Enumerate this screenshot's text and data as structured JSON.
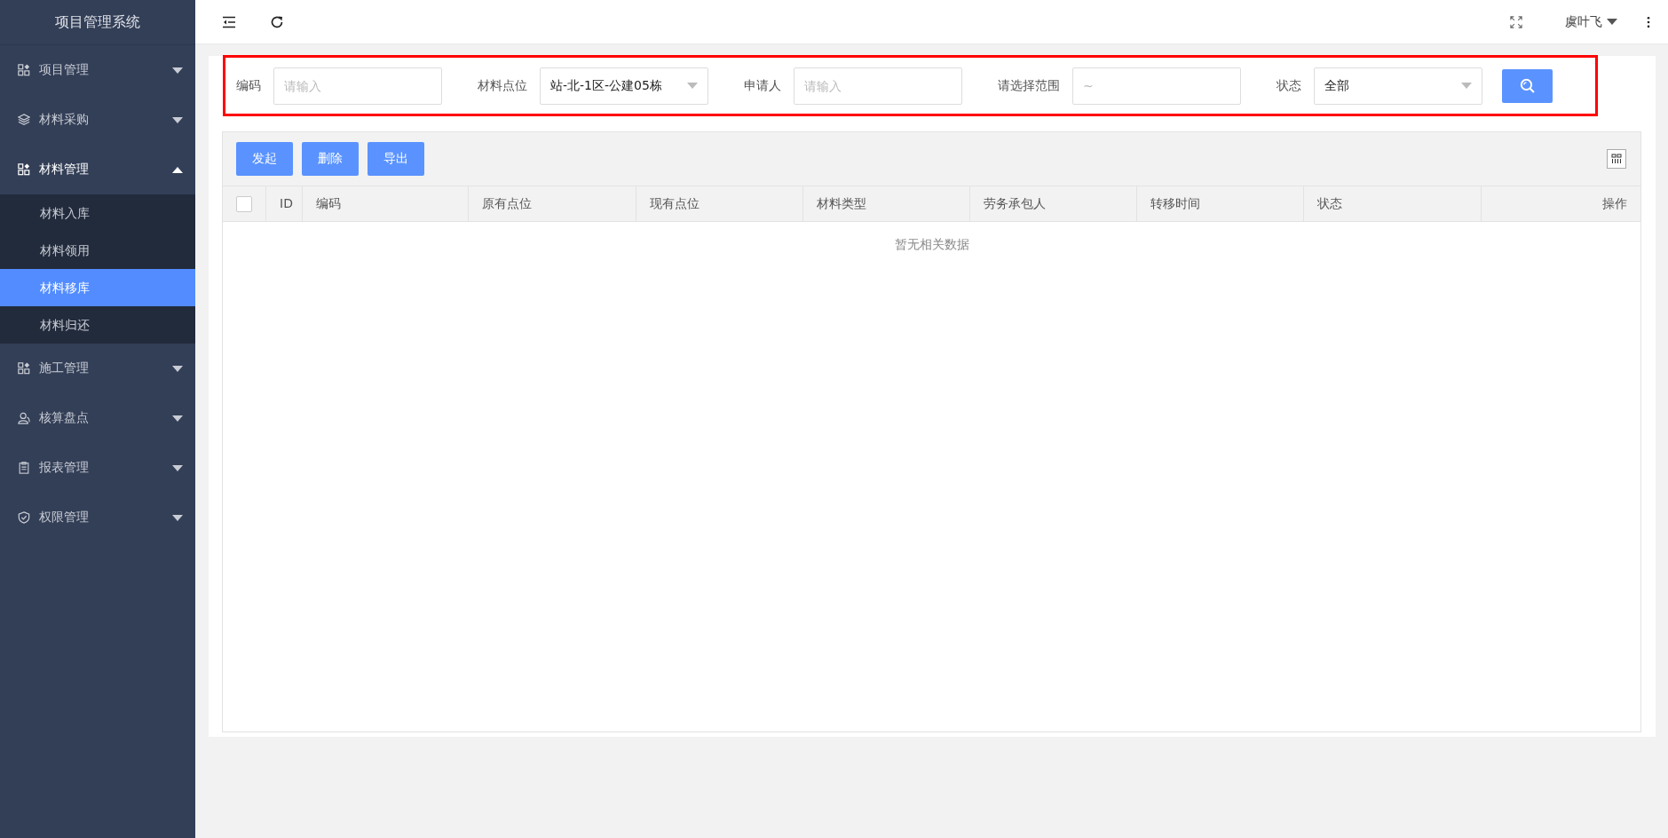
{
  "sidebar": {
    "title": "项目管理系统",
    "items": [
      {
        "label": "项目管理",
        "expanded": false
      },
      {
        "label": "材料采购",
        "expanded": false
      },
      {
        "label": "材料管理",
        "expanded": true,
        "children": [
          {
            "label": "材料入库",
            "selected": false
          },
          {
            "label": "材料领用",
            "selected": false
          },
          {
            "label": "材料移库",
            "selected": true
          },
          {
            "label": "材料归还",
            "selected": false
          }
        ]
      },
      {
        "label": "施工管理",
        "expanded": false
      },
      {
        "label": "核算盘点",
        "expanded": false
      },
      {
        "label": "报表管理",
        "expanded": false
      },
      {
        "label": "权限管理",
        "expanded": false
      }
    ]
  },
  "header": {
    "user": "虞叶飞"
  },
  "filters": [
    {
      "kind": "input",
      "label": "编码",
      "placeholder": "请输入"
    },
    {
      "kind": "select",
      "label": "材料点位",
      "value": "站-北-1区-公建05栋"
    },
    {
      "kind": "input",
      "label": "申请人",
      "placeholder": "请输入"
    },
    {
      "kind": "input",
      "label": "请选择范围",
      "placeholder": "~"
    },
    {
      "kind": "select",
      "label": "状态",
      "value": "全部"
    }
  ],
  "toolbar": {
    "buttons": [
      "发起",
      "删除",
      "导出"
    ]
  },
  "table": {
    "select_all_checked": false,
    "columns": [
      "ID",
      "编码",
      "原有点位",
      "现有点位",
      "材料类型",
      "劳务承包人",
      "转移时间",
      "状态",
      "操作"
    ],
    "empty_text": "暂无相关数据"
  }
}
